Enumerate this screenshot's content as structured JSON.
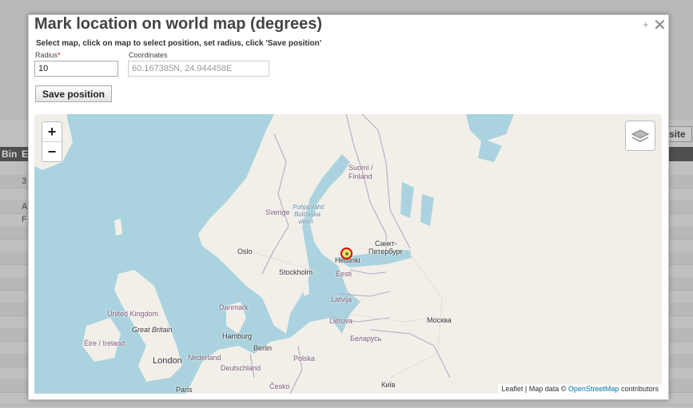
{
  "background": {
    "header_cols": [
      "Bin",
      "E"
    ],
    "row_cells": [
      "3",
      "A",
      "F"
    ],
    "button_label": "site"
  },
  "dialog": {
    "title": "Mark location on world map (degrees)",
    "plus_label": "+",
    "close_label": "✕",
    "instructions": "Select map, click on map to select position, set radius, click 'Save position'",
    "radius": {
      "label": "Radius",
      "required_mark": "*",
      "value": "10"
    },
    "coordinates": {
      "label": "Coordinates",
      "value": "60.167385N, 24.944458E"
    },
    "save_button": "Save position"
  },
  "map": {
    "zoom_in": "+",
    "zoom_out": "−",
    "labels": {
      "suomi": "Suomi /",
      "finland": "Finland",
      "sverige": "Sverige",
      "pohjanlahti": "Pohjanlahti",
      "bottniska": "Bottniska",
      "viken": "viken",
      "oslo": "Oslo",
      "stockholm": "Stockholm",
      "helsinki": "Helsinki",
      "sankt": "Санкт-",
      "peterburg": "Петербург",
      "eesti": "Eesti",
      "latvija": "Latvija",
      "lietuva": "Lietuva",
      "belarus": "Беларусь",
      "moskva": "Москва",
      "kyiv": "Київ",
      "danmark": "Danmark",
      "hamburg": "Hamburg",
      "berlin": "Berlin",
      "polska": "Polska",
      "nederland": "Nederland",
      "deutschland": "Deutschland",
      "cesko": "Česko",
      "united_kingdom": "United Kingdom",
      "great_britain": "Great Britain",
      "eire": "Éire / Ireland",
      "london": "London",
      "paris": "Paris"
    },
    "attribution": {
      "prefix": "Leaflet | Map data ©",
      "link": "OpenStreetMap",
      "suffix": "contributors"
    },
    "colors": {
      "water": "#aad3df",
      "land": "#f2efe9",
      "border": "#b9a8c4",
      "marker": "#dd0000"
    }
  }
}
